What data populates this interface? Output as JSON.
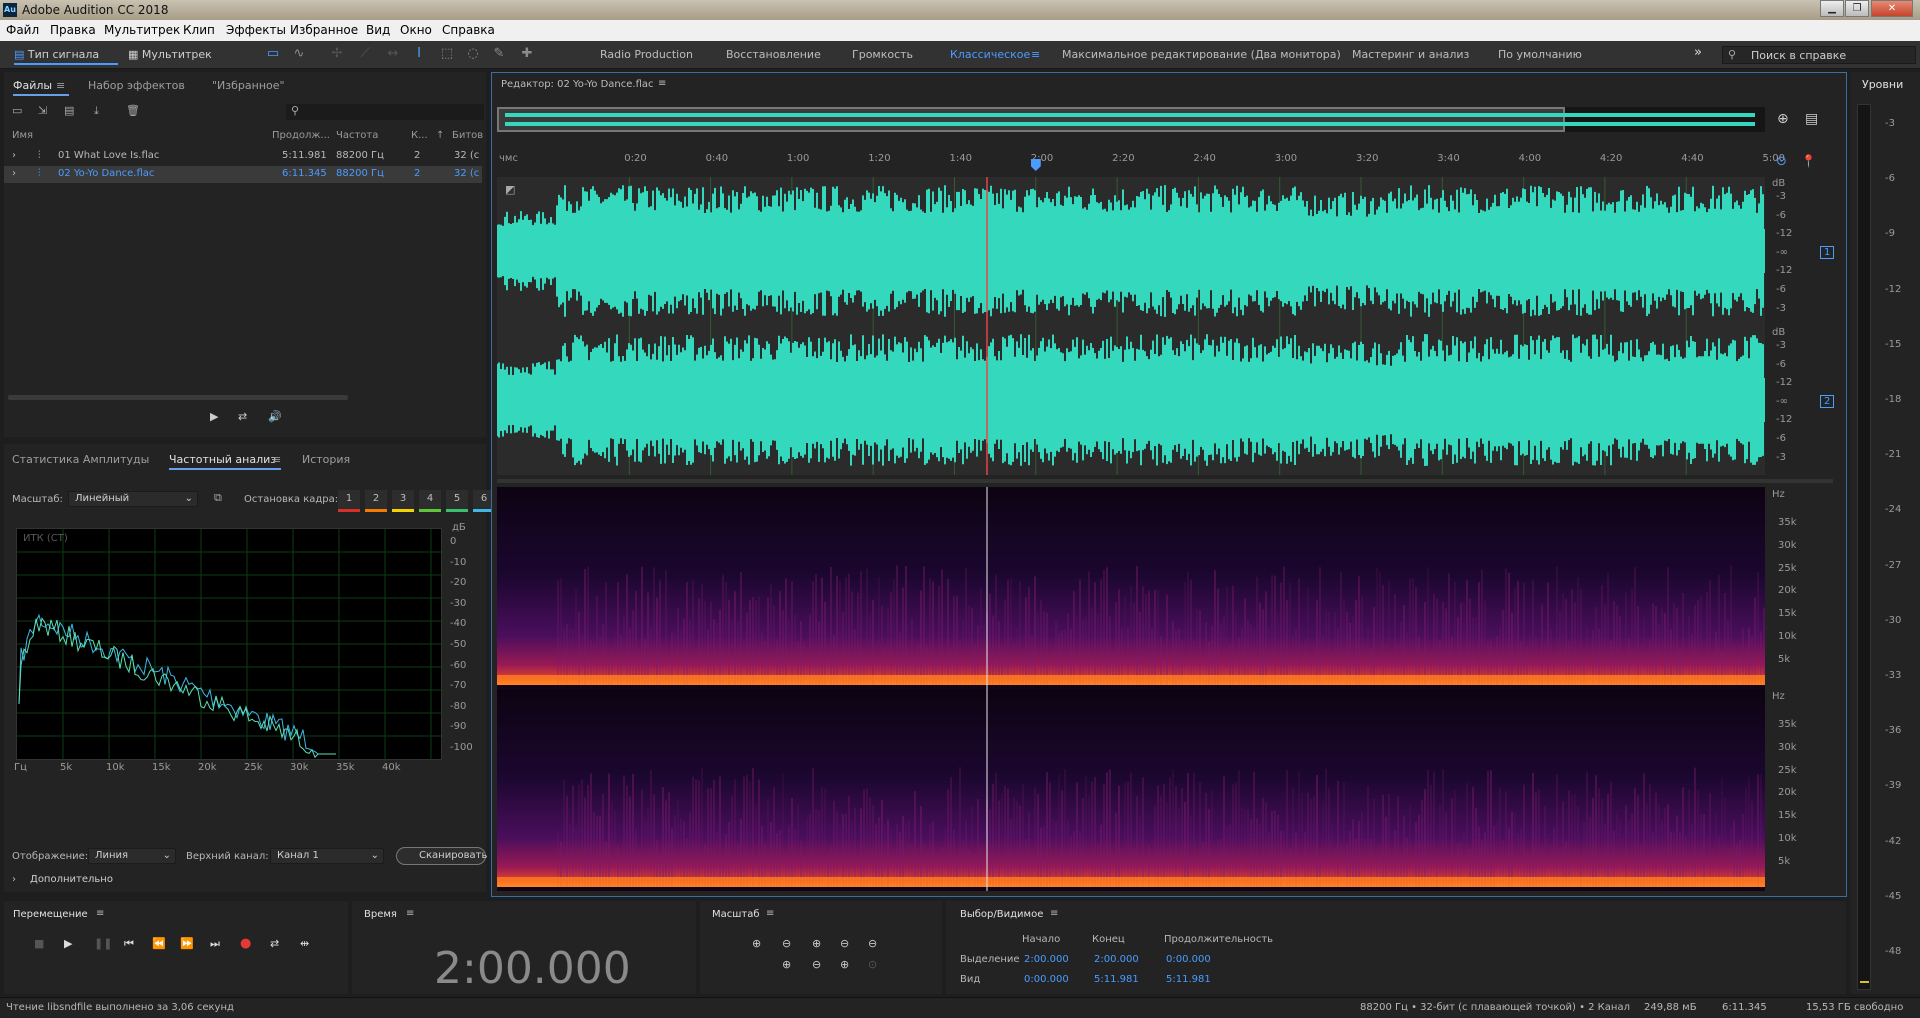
{
  "window": {
    "title": "Adobe Audition CC 2018",
    "logo": "Au"
  },
  "menu": [
    "Файл",
    "Правка",
    "Мультитрек",
    "Клип",
    "Эффекты",
    "Избранное",
    "Вид",
    "Окно",
    "Справка"
  ],
  "toolbar": {
    "mode_waveform": "Тип сигнала",
    "mode_multitrack": "Мультитрек",
    "workspaces": [
      "Radio Production",
      "Восстановление",
      "Громкость",
      "Классическое",
      "Максимальное редактирование (Два монитора)",
      "Мастеринг и анализ",
      "По умолчанию"
    ],
    "active_workspace": "Классическое",
    "help_search_placeholder": "Поиск в справке"
  },
  "files_panel": {
    "tabs": [
      "Файлы",
      "Набор эффектов",
      "\"Избранное\""
    ],
    "columns": [
      "Имя",
      "Продолж...",
      "Частота",
      "К...",
      "Битов"
    ],
    "rows": [
      {
        "name": "01 What Love Is.flac",
        "duration": "5:11.981",
        "rate": "88200 Гц",
        "ch": "2",
        "bits": "32 (с"
      },
      {
        "name": "02 Yo-Yo Dance.flac",
        "duration": "6:11.345",
        "rate": "88200 Гц",
        "ch": "2",
        "bits": "32 (с"
      }
    ]
  },
  "analysis_panel": {
    "tabs": [
      "Статистика Амплитуды",
      "Частотный анализ",
      "История"
    ],
    "scale_label": "Масштаб:",
    "scale_value": "Линейный",
    "freeze_label": "Остановка кадра:",
    "freeze_slots": [
      "1",
      "2",
      "3",
      "4",
      "5",
      "6"
    ],
    "freeze_colors": [
      "#d93025",
      "#f57c00",
      "#f4d300",
      "#5ec639",
      "#39c06e",
      "#3fb8e8"
    ],
    "plot_label": "ИТК (СТ)",
    "db_unit": "дБ",
    "db_ticks": [
      "0",
      "-10",
      "-20",
      "-30",
      "-40",
      "-50",
      "-60",
      "-70",
      "-80",
      "-90",
      "-100"
    ],
    "freq_ticks": [
      "Гц",
      "5k",
      "10k",
      "15k",
      "20k",
      "25k",
      "30k",
      "35k",
      "40k"
    ],
    "display_label": "Отображение:",
    "display_value": "Линия",
    "top_channel_label": "Верхний канал:",
    "top_channel_value": "Канал 1",
    "scan_button": "Сканировать",
    "more": "Дополнительно"
  },
  "editor": {
    "title": "Редактор: 02 Yo-Yo Dance.flac",
    "time_ticks": [
      "чмс",
      "0:20",
      "0:40",
      "1:00",
      "1:20",
      "1:40",
      "2:00",
      "2:20",
      "2:40",
      "3:00",
      "3:20",
      "3:40",
      "4:00",
      "4:20",
      "4:40",
      "5:00"
    ],
    "db_unit": "dB",
    "db_ticks": [
      "-3",
      "-6",
      "-12",
      "-∞",
      "-12",
      "-6",
      "-3"
    ],
    "channel_badges": [
      "1",
      "2"
    ],
    "hz_unit": "Hz",
    "hz_ticks": [
      "35k",
      "30k",
      "25k",
      "20k",
      "15k",
      "10k",
      "5k"
    ],
    "playhead_time": "2:00"
  },
  "levels": {
    "title": "Уровни",
    "ticks": [
      "-3",
      "-6",
      "-9",
      "-12",
      "-15",
      "-18",
      "-21",
      "-24",
      "-27",
      "-30",
      "-33",
      "-36",
      "-39",
      "-42",
      "-45",
      "-48"
    ]
  },
  "transport": {
    "title": "Перемещение"
  },
  "time_panel": {
    "title": "Время",
    "value": "2:00.000"
  },
  "zoom_panel": {
    "title": "Масштаб"
  },
  "selection_panel": {
    "title": "Выбор/Видимое",
    "headers": [
      "Начало",
      "Конец",
      "Продолжительность"
    ],
    "rows": [
      {
        "label": "Выделение",
        "start": "2:00.000",
        "end": "2:00.000",
        "duration": "0:00.000"
      },
      {
        "label": "Вид",
        "start": "0:00.000",
        "end": "5:11.981",
        "duration": "5:11.981"
      }
    ]
  },
  "status": {
    "left": "Чтение libsndfile выполнено за 3,06 секунд",
    "format": "88200 Гц • 32-бит (с плавающей точкой) • 2 Канал",
    "size": "249,88 мБ",
    "duration": "6:11.345",
    "free": "15,53 ГБ свободно"
  },
  "colors": {
    "accent": "#4a9cff",
    "waveform": "#33d8bd",
    "playhead": "#e64545"
  }
}
